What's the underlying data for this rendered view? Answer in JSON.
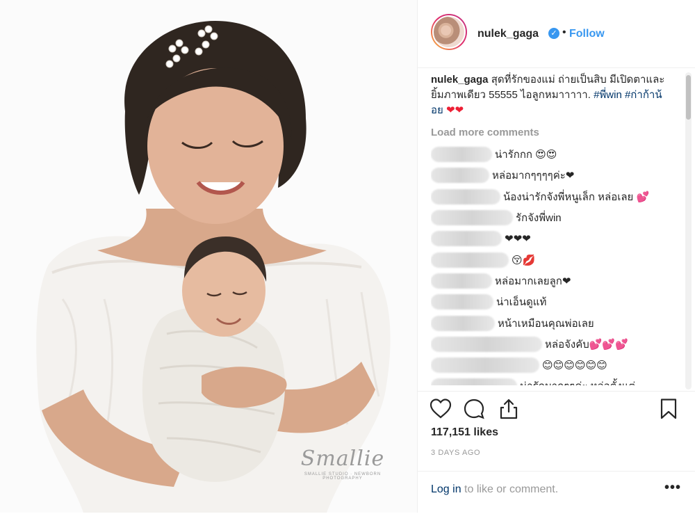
{
  "post": {
    "username": "nulek_gaga",
    "separator": "•",
    "follow_label": "Follow",
    "verified_glyph": "✓",
    "caption": {
      "username": "nulek_gaga",
      "text": "สุดที่รักของแม่ ถ่ายเป็นสิบ มีเปิดตาและยิ้มภาพเดียว 55555 ไอลูกหมาาาาา.",
      "hashtags": "#พี่win #ก่าก้าน้อย",
      "hearts": "❤❤"
    },
    "load_more_label": "Load more comments",
    "comments": [
      {
        "text": "น่ารักกก 😍😍"
      },
      {
        "text": "หล่อมากๆๆๆๆค่ะ❤"
      },
      {
        "text": "น้องน่ารักจังพี่หนูเล็ก หล่อเลย 💕"
      },
      {
        "text": "รักจังพี่win"
      },
      {
        "text": "❤❤❤"
      },
      {
        "text": "😚💋"
      },
      {
        "text": "หล่อมากเลยลูก❤"
      },
      {
        "text": "น่าเอ็นดูแท้"
      },
      {
        "text": "หน้าเหมือนคุณพ่อเลย"
      },
      {
        "text": "หล่อจังคับ💕💕💕"
      },
      {
        "text": "😊😊😊😊😊😊"
      },
      {
        "text": "น่ารักมากๆๆค่ะ หล่อตั้งแต่"
      }
    ],
    "likes_label": "117,151 likes",
    "time_label": "3 DAYS AGO",
    "login_link": "Log in",
    "login_rest": " to like or comment.",
    "more_label": "•••"
  },
  "watermark": {
    "name": "Smallie",
    "subtitle": "SMALLIE STUDIO · NEWBORN PHOTOGRAPHY"
  },
  "icons": [
    "heart-icon",
    "comment-icon",
    "share-icon",
    "bookmark-icon",
    "verified-badge-icon",
    "more-options-icon"
  ],
  "colors": {
    "link_blue": "#3897f0",
    "hashtag_navy": "#003569",
    "muted_gray": "#999999",
    "text": "#262626",
    "heart_red": "#ed1f34"
  }
}
